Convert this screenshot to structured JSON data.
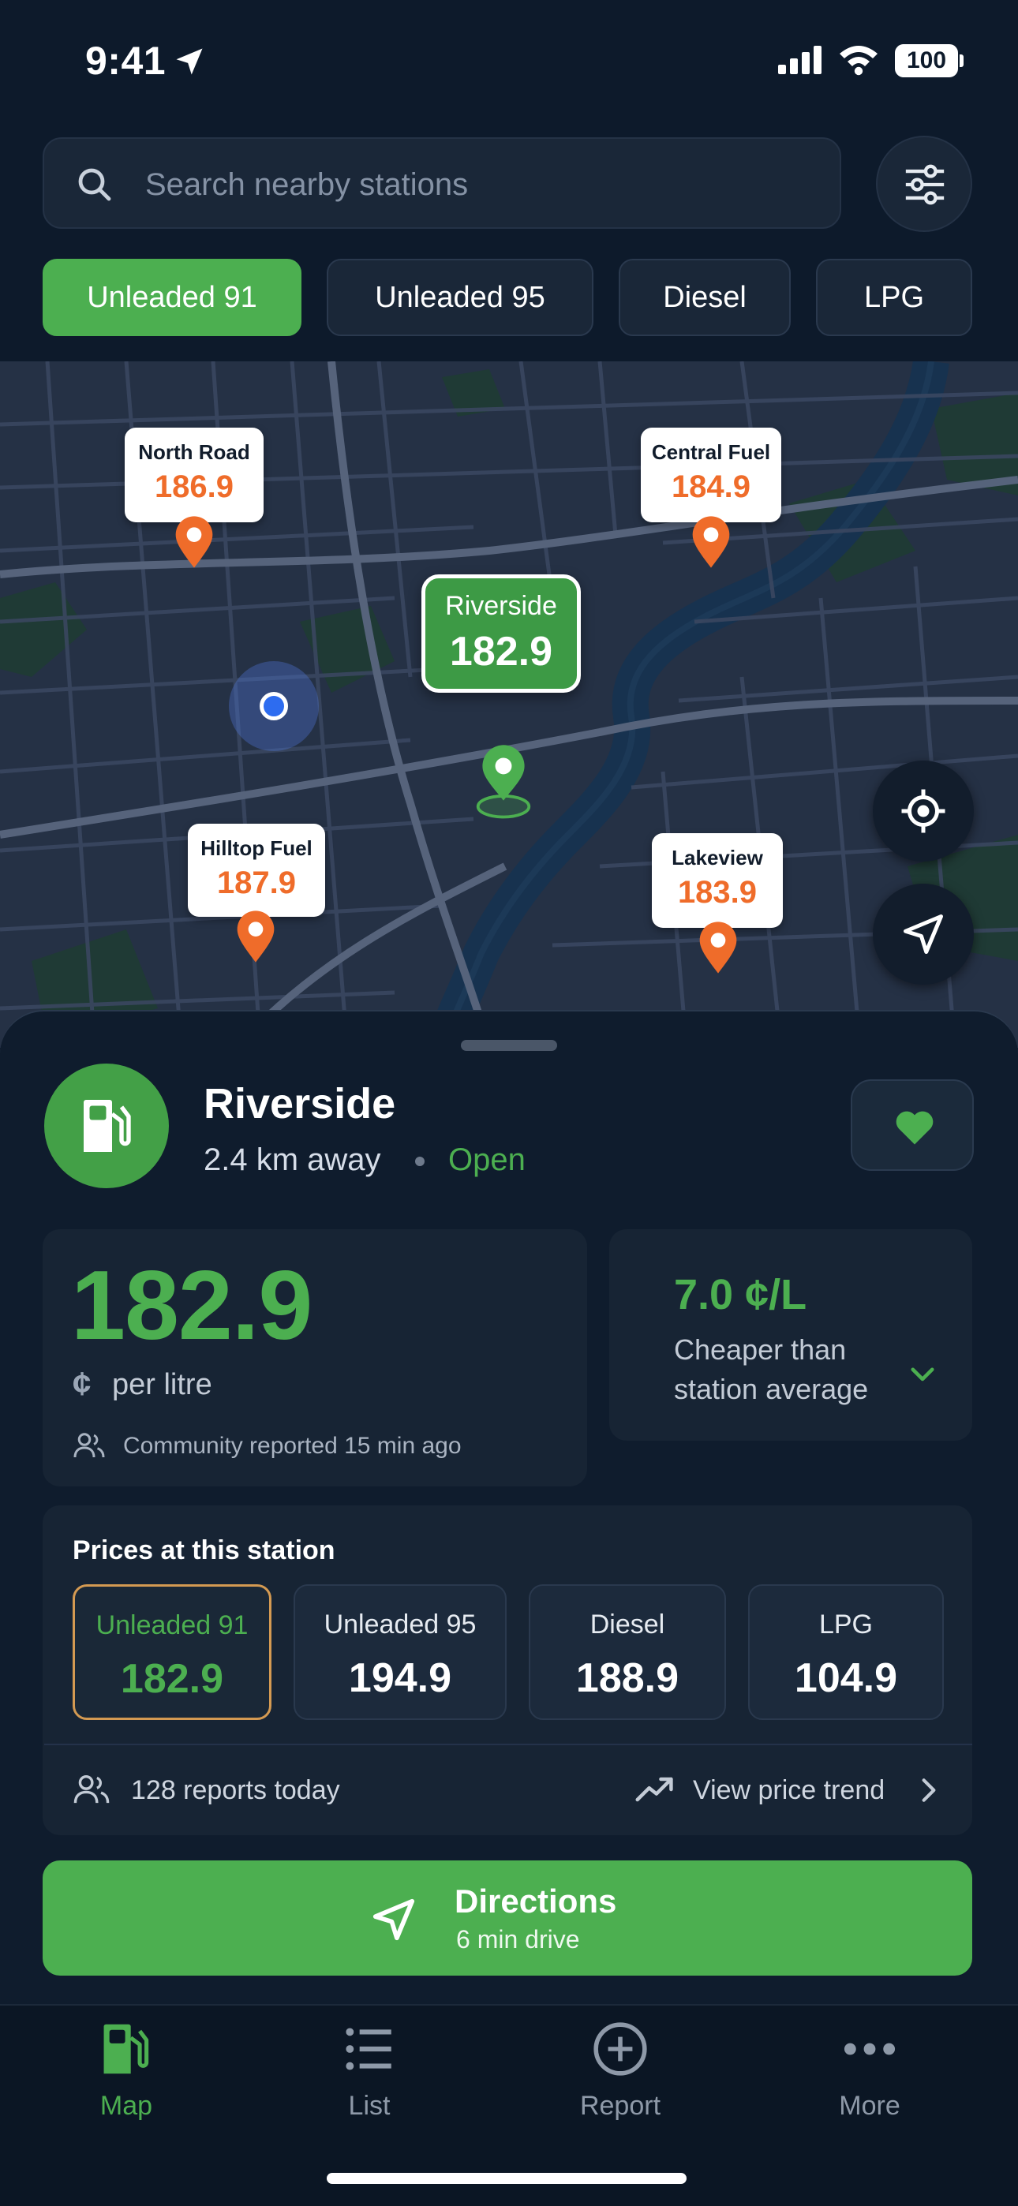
{
  "status_bar": {
    "time": "9:41",
    "battery": "100"
  },
  "search": {
    "placeholder": "Search nearby stations"
  },
  "fuel_types": [
    "Unleaded 91",
    "Unleaded 95",
    "Diesel",
    "LPG"
  ],
  "selected_fuel": "Unleaded 91",
  "map": {
    "stations": [
      {
        "name": "North Road",
        "price": "186.9"
      },
      {
        "name": "Central Fuel",
        "price": "184.9"
      },
      {
        "name": "Riverside",
        "price": "182.9"
      },
      {
        "name": "Hilltop Fuel",
        "price": "187.9"
      },
      {
        "name": "Lakeview",
        "price": "183.9"
      }
    ]
  },
  "station": {
    "name": "Riverside",
    "distance": "2.4 km away",
    "status": "Open",
    "price": "182.9",
    "currency_symbol": "¢",
    "unit": "per litre",
    "reported": "Community reported 15 min ago",
    "saving_value": "7.0 ¢/L",
    "saving_desc": "Cheaper than station average"
  },
  "prices_section": {
    "title": "Prices at this station",
    "items": [
      {
        "label": "Unleaded 91",
        "price": "182.9"
      },
      {
        "label": "Unleaded 95",
        "price": "194.9"
      },
      {
        "label": "Diesel",
        "price": "188.9"
      },
      {
        "label": "LPG",
        "price": "104.9"
      }
    ],
    "reports": "128 reports today",
    "trend_link": "View price trend"
  },
  "directions": {
    "label": "Directions",
    "sub": "6 min drive"
  },
  "tabs": [
    {
      "label": "Map",
      "icon": "fuel-pump-icon"
    },
    {
      "label": "List",
      "icon": "list-icon"
    },
    {
      "label": "Report",
      "icon": "plus-circle-icon"
    },
    {
      "label": "More",
      "icon": "more-icon"
    }
  ],
  "colors": {
    "accent": "#4caf50",
    "price_orange": "#ef6c2a",
    "background": "#0d1a2b",
    "surface": "#172434"
  }
}
